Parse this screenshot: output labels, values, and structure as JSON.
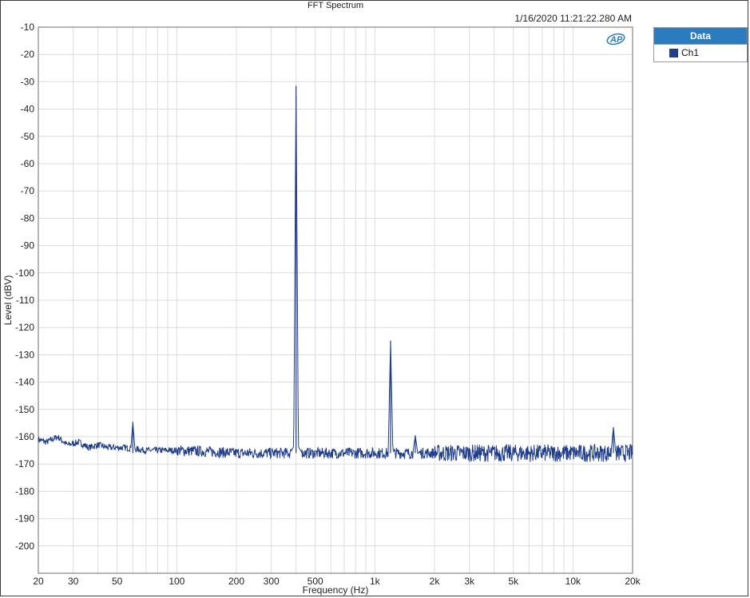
{
  "header": {
    "title": "FFT Spectrum",
    "timestamp": "1/16/2020 11:21:22.280 AM"
  },
  "legend": {
    "title": "Data",
    "items": [
      {
        "label": "Ch1",
        "color": "#1f3d8c"
      }
    ]
  },
  "logo": {
    "text": "AP"
  },
  "chart_data": {
    "type": "line",
    "title": "FFT Spectrum",
    "xlabel": "Frequency (Hz)",
    "ylabel": "Level (dBV)",
    "x_scale": "log",
    "xlim": [
      20,
      20000
    ],
    "ylim": [
      -210,
      -10
    ],
    "grid": true,
    "legend_position": "right",
    "x_ticks": [
      {
        "v": 20,
        "l": "20"
      },
      {
        "v": 30,
        "l": "30"
      },
      {
        "v": 50,
        "l": "50"
      },
      {
        "v": 100,
        "l": "100"
      },
      {
        "v": 200,
        "l": "200"
      },
      {
        "v": 300,
        "l": "300"
      },
      {
        "v": 500,
        "l": "500"
      },
      {
        "v": 1000,
        "l": "1k"
      },
      {
        "v": 2000,
        "l": "2k"
      },
      {
        "v": 3000,
        "l": "3k"
      },
      {
        "v": 5000,
        "l": "5k"
      },
      {
        "v": 10000,
        "l": "10k"
      },
      {
        "v": 20000,
        "l": "20k"
      }
    ],
    "y_ticks": [
      -10,
      -20,
      -30,
      -40,
      -50,
      -60,
      -70,
      -80,
      -90,
      -100,
      -110,
      -120,
      -130,
      -140,
      -150,
      -160,
      -170,
      -180,
      -190,
      -200
    ],
    "series": [
      {
        "name": "Ch1",
        "color": "#1f3d8c",
        "noise_floor": [
          [
            20,
            -161
          ],
          [
            22,
            -162
          ],
          [
            25,
            -160
          ],
          [
            28,
            -163
          ],
          [
            32,
            -162
          ],
          [
            36,
            -164
          ],
          [
            40,
            -163
          ],
          [
            45,
            -164
          ],
          [
            55,
            -164
          ],
          [
            70,
            -165
          ],
          [
            100,
            -165
          ],
          [
            150,
            -165.5
          ],
          [
            200,
            -166
          ],
          [
            300,
            -166
          ],
          [
            500,
            -166
          ],
          [
            1000,
            -166
          ],
          [
            2000,
            -166
          ],
          [
            5000,
            -166
          ],
          [
            10000,
            -166
          ],
          [
            20000,
            -166
          ]
        ],
        "peaks": [
          {
            "f": 60,
            "level": -154.5
          },
          {
            "f": 400,
            "level": -31.5
          },
          {
            "f": 1200,
            "level": -124.8
          },
          {
            "f": 1600,
            "level": -159.5
          },
          {
            "f": 16000,
            "level": -156.5
          }
        ]
      }
    ]
  }
}
